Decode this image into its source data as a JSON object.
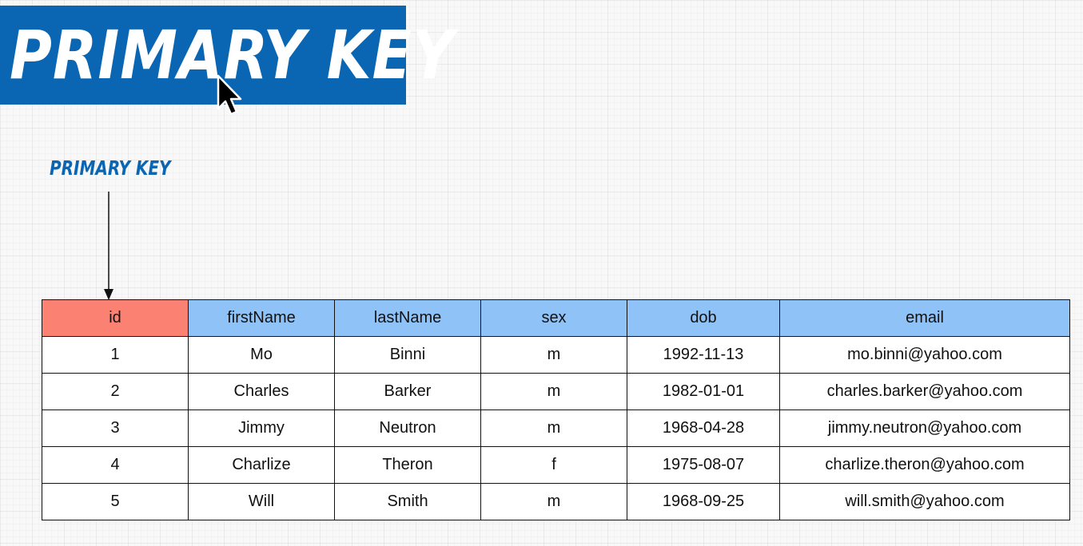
{
  "banner": {
    "title": "PRIMARY KEY",
    "background": "#0a66b3"
  },
  "annotation": {
    "label": "PRIMARY KEY",
    "color": "#0a66b3",
    "arrow_icon": "arrow-down-icon"
  },
  "table": {
    "header_color": "#8fc3f7",
    "primary_key_header_color": "#fb8173",
    "columns": [
      "id",
      "firstName",
      "lastName",
      "sex",
      "dob",
      "email"
    ],
    "rows": [
      [
        "1",
        "Mo",
        "Binni",
        "m",
        "1992-11-13",
        "mo.binni@yahoo.com"
      ],
      [
        "2",
        "Charles",
        "Barker",
        "m",
        "1982-01-01",
        "charles.barker@yahoo.com"
      ],
      [
        "3",
        "Jimmy",
        "Neutron",
        "m",
        "1968-04-28",
        "jimmy.neutron@yahoo.com"
      ],
      [
        "4",
        "Charlize",
        "Theron",
        "f",
        "1975-08-07",
        "charlize.theron@yahoo.com"
      ],
      [
        "5",
        "Will",
        "Smith",
        "m",
        "1968-09-25",
        "will.smith@yahoo.com"
      ]
    ]
  }
}
